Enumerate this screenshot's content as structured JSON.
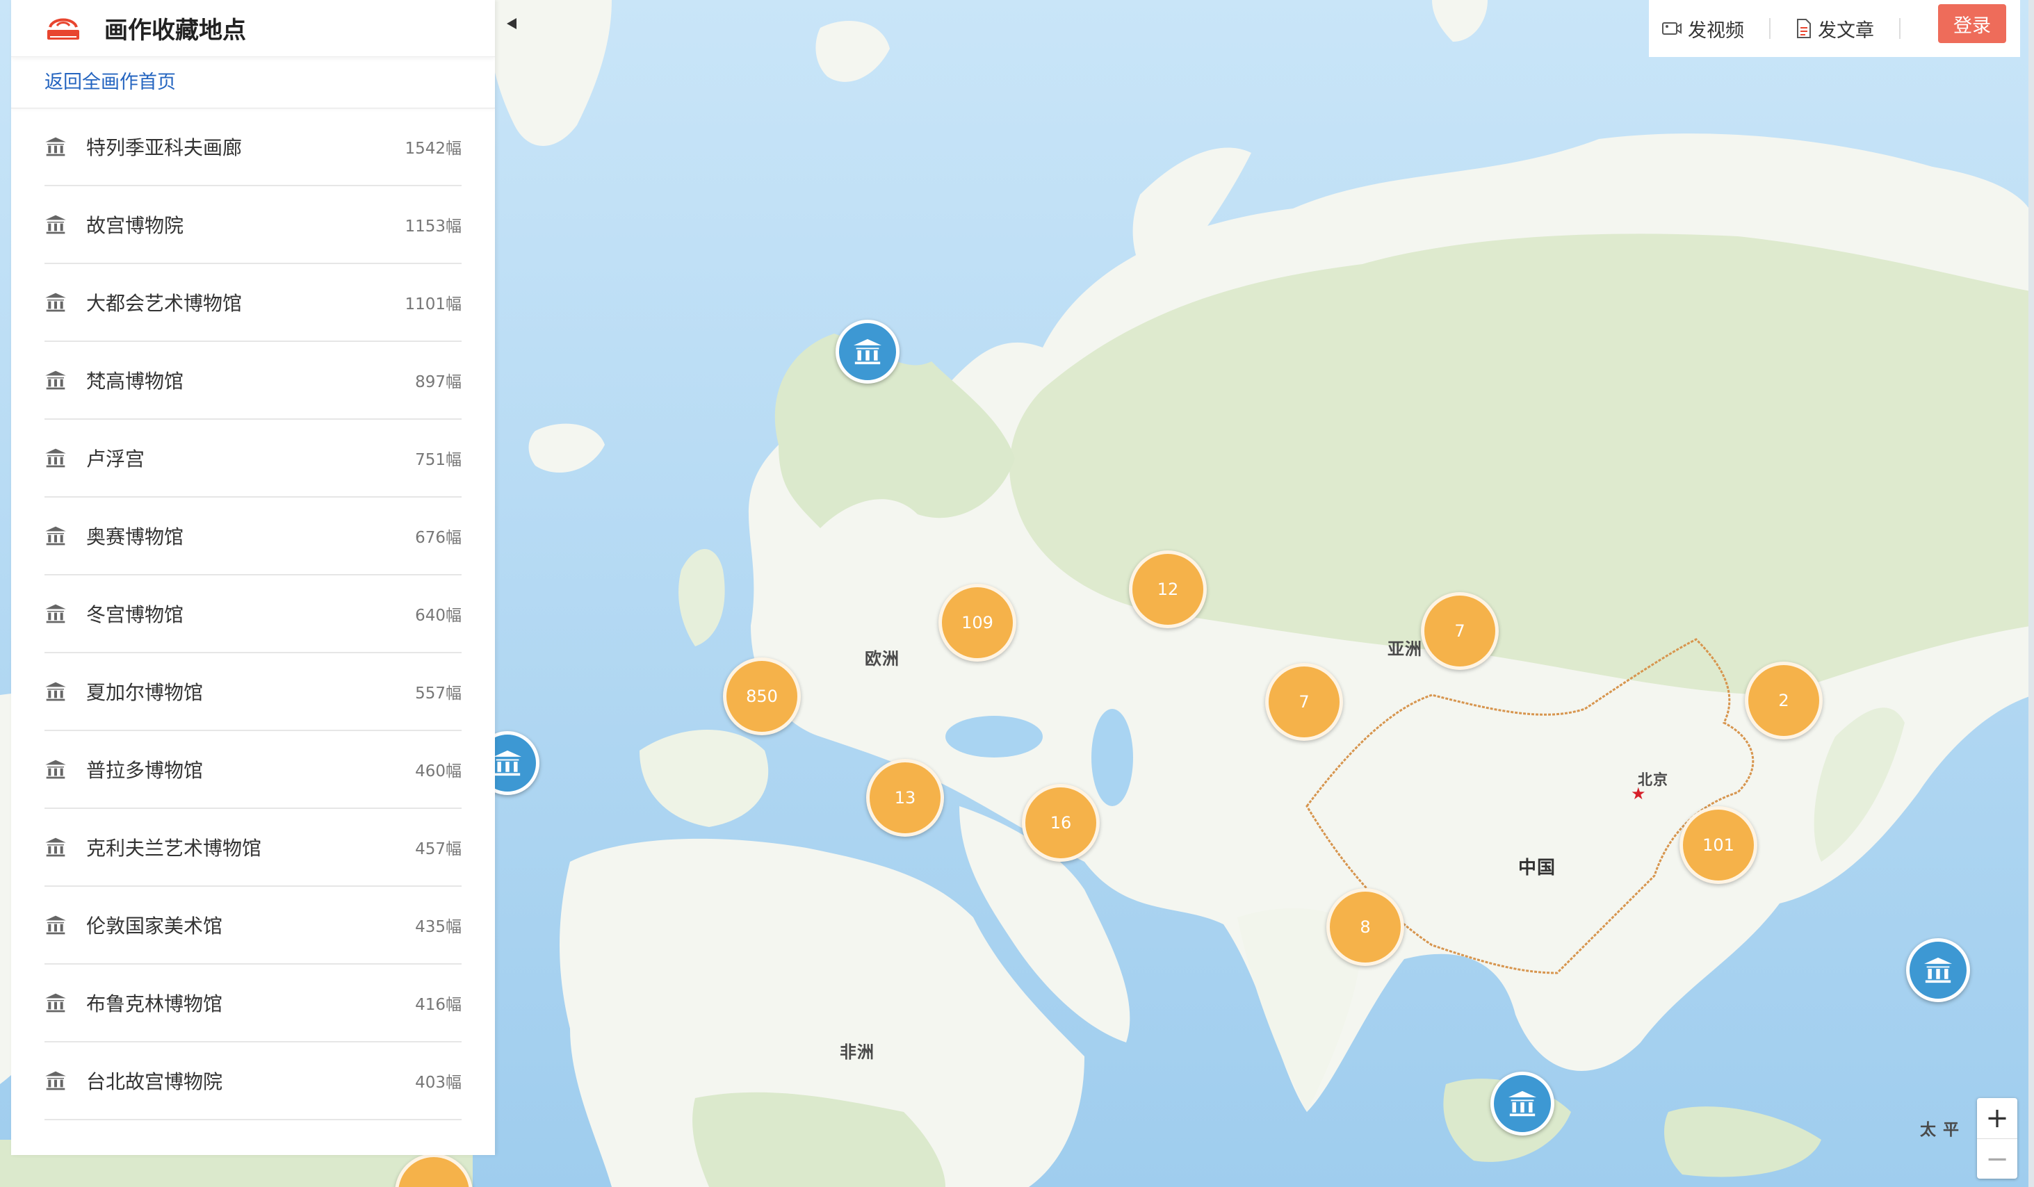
{
  "sidebar": {
    "title": "画作收藏地点",
    "back_link": "返回全画作首页",
    "museums": [
      {
        "name": "特列季亚科夫画廊",
        "count": "1542幅"
      },
      {
        "name": "故宫博物院",
        "count": "1153幅"
      },
      {
        "name": "大都会艺术博物馆",
        "count": "1101幅"
      },
      {
        "name": "梵高博物馆",
        "count": "897幅"
      },
      {
        "name": "卢浮宫",
        "count": "751幅"
      },
      {
        "name": "奥赛博物馆",
        "count": "676幅"
      },
      {
        "name": "冬宫博物馆",
        "count": "640幅"
      },
      {
        "name": "夏加尔博物馆",
        "count": "557幅"
      },
      {
        "name": "普拉多博物馆",
        "count": "460幅"
      },
      {
        "name": "克利夫兰艺术博物馆",
        "count": "457幅"
      },
      {
        "name": "伦敦国家美术馆",
        "count": "435幅"
      },
      {
        "name": "布鲁克林博物馆",
        "count": "416幅"
      },
      {
        "name": "台北故宫博物院",
        "count": "403幅"
      }
    ]
  },
  "toolbar": {
    "video": "发视频",
    "article": "发文章",
    "login": "登录"
  },
  "map": {
    "labels": {
      "europe": "欧洲",
      "asia": "亚洲",
      "africa": "非洲",
      "china": "中国",
      "beijing": "北京",
      "pacific": "太 平"
    },
    "clusters": [
      "850",
      "109",
      "12",
      "7",
      "7",
      "2",
      "13",
      "16",
      "101",
      "8"
    ],
    "zoom_in": "+",
    "zoom_out": "−"
  },
  "colors": {
    "ocean": "#a9d4f2",
    "land": "#f4f6f0",
    "forest": "#d9e8c8",
    "cluster": "#f5b24a",
    "museum_marker": "#3d98d3",
    "link": "#2565c0",
    "login": "#ee6c5a"
  }
}
